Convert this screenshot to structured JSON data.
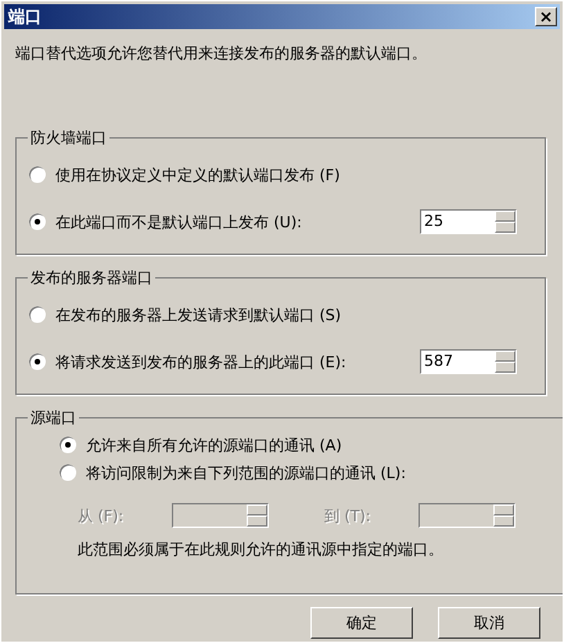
{
  "window": {
    "title": "端口",
    "close": "×"
  },
  "description": "端口替代选项允许您替代用来连接发布的服务器的默认端口。",
  "groups": [
    {
      "title": "防火墙端口",
      "options": [
        {
          "label": "使用在协议定义中定义的默认端口发布 (F)",
          "selected": false
        },
        {
          "label": "在此端口而不是默认端口上发布 (U):",
          "selected": true,
          "value": "25"
        }
      ]
    },
    {
      "title": "发布的服务器端口",
      "options": [
        {
          "label": "在发布的服务器上发送请求到默认端口 (S)",
          "selected": false
        },
        {
          "label": "将请求发送到发布的服务器上的此端口 (E):",
          "selected": true,
          "value": "587"
        }
      ]
    }
  ],
  "source_port": {
    "title": "源端口",
    "options": [
      {
        "label": "允许来自所有允许的源端口的通讯 (A)",
        "selected": true
      },
      {
        "label": "将访问限制为来自下列范围的源端口的通讯 (L):",
        "selected": false
      }
    ],
    "range": [
      {
        "label": "从 (F):",
        "disabled": true
      },
      {
        "label": "到 (T):",
        "disabled": true
      }
    ],
    "note": "此范围必须属于在此规则允许的通讯源中指定的端口。"
  },
  "buttons": [
    "确定",
    "取消"
  ]
}
